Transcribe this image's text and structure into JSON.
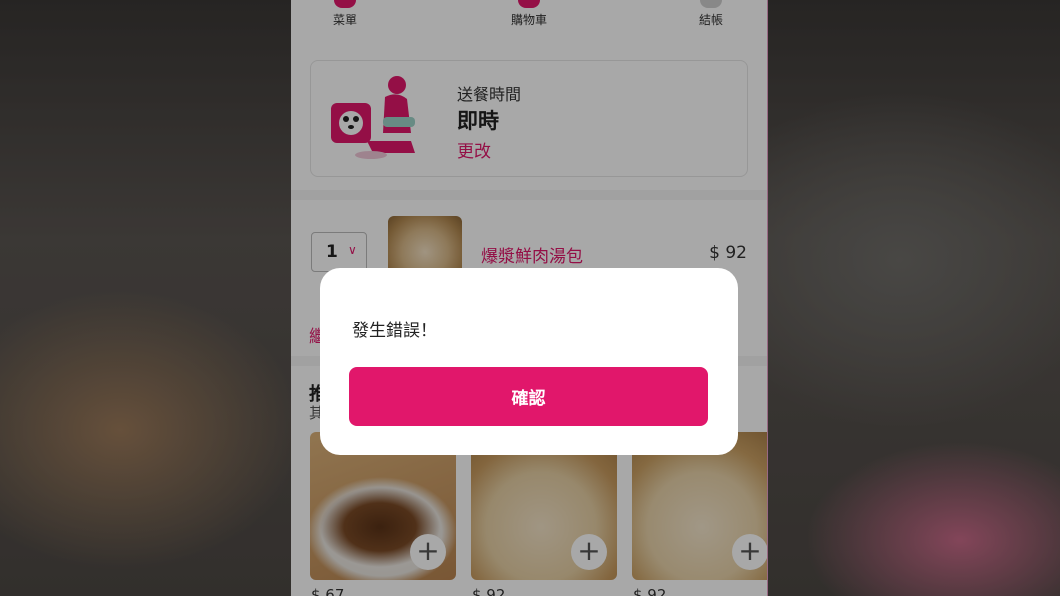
{
  "steps": [
    {
      "label": "菜單",
      "active": true
    },
    {
      "label": "購物車",
      "active": true
    },
    {
      "label": "結帳",
      "active": false
    }
  ],
  "delivery": {
    "label": "送餐時間",
    "value": "即時",
    "change_link": "更改"
  },
  "cart_item": {
    "quantity": "1",
    "name": "爆漿鮮肉湯包",
    "price": "$ 92"
  },
  "partial_text": {
    "continue_link": "繼",
    "rec_title": "推",
    "rec_subtitle": "其"
  },
  "recommendations": [
    {
      "price": "$ 67"
    },
    {
      "price": "$ 92"
    },
    {
      "price": "$ 92"
    }
  ],
  "dialog": {
    "message": "發生錯誤！",
    "confirm_label": "確認"
  },
  "colors": {
    "brand": "#e1176b",
    "overlay": "rgba(0,0,0,0.34)"
  }
}
